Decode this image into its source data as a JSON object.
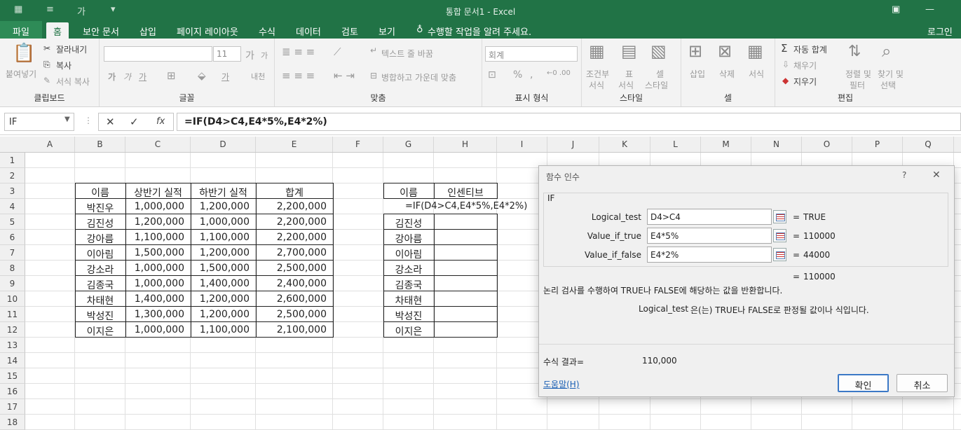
{
  "titlebar": {
    "title": "통합 문서1  -  Excel",
    "qa_undo": "↶",
    "qa_text": "가"
  },
  "tabs": {
    "file": "파일",
    "home": "홈",
    "insert_doc": "보안 문서",
    "insert": "삽입",
    "layout": "페이지 레이아웃",
    "formulas": "수식",
    "data": "데이터",
    "review": "검토",
    "view": "보기",
    "tell": "수행할 작업을 알려 주세요.",
    "login": "로그인"
  },
  "ribbon": {
    "clipboard": {
      "paste": "붙여넣기",
      "cut": "잘라내기",
      "copy": "복사",
      "format_painter": "서식 복사",
      "label": "클립보드"
    },
    "font": {
      "size": "11",
      "grow": "가",
      "shrink": "가",
      "bold": "가",
      "italic": "가",
      "underline": "가",
      "fontcolor": "가",
      "phonetic": "내천",
      "label": "글꼴"
    },
    "align": {
      "wrap": "텍스트 줄 바꿈",
      "merge": "병합하고 가운데 맞춤",
      "label": "맞춤"
    },
    "number": {
      "format": "회계",
      "percent": "%",
      "comma": ",",
      "label": "표시 형식"
    },
    "styles": {
      "cond": "조건부",
      "cond2": "서식",
      "table": "표",
      "table2": "서식",
      "cell": "셀",
      "cell2": "스타일",
      "label": "스타일"
    },
    "cells": {
      "insert": "삽입",
      "delete": "삭제",
      "format": "서식",
      "label": "셀"
    },
    "edit": {
      "autosum": "자동 합계",
      "fill": "채우기",
      "clear": "지우기",
      "sort": "정렬 및",
      "sort2": "필터",
      "find": "찾기 및",
      "find2": "선택",
      "label": "편집"
    }
  },
  "formula_bar": {
    "name_box": "IF",
    "formula": "=IF(D4>C4,E4*5%,E4*2%)",
    "fx": "fx"
  },
  "columns": [
    "A",
    "B",
    "C",
    "D",
    "E",
    "F",
    "G",
    "H",
    "I",
    "J",
    "K",
    "L",
    "M",
    "N",
    "O",
    "P",
    "Q"
  ],
  "rows": [
    "1",
    "2",
    "3",
    "4",
    "5",
    "6",
    "7",
    "8",
    "9",
    "10",
    "11",
    "12",
    "13",
    "14",
    "15",
    "16",
    "17",
    "18"
  ],
  "table1": {
    "headers": [
      "이름",
      "상반기 실적",
      "하반기 실적",
      "합계"
    ],
    "rows": [
      [
        "박진우",
        "1,000,000",
        "1,200,000",
        "2,200,000"
      ],
      [
        "김진성",
        "1,200,000",
        "1,000,000",
        "2,200,000"
      ],
      [
        "강아름",
        "1,100,000",
        "1,100,000",
        "2,200,000"
      ],
      [
        "이아림",
        "1,500,000",
        "1,200,000",
        "2,700,000"
      ],
      [
        "강소라",
        "1,000,000",
        "1,500,000",
        "2,500,000"
      ],
      [
        "김종국",
        "1,000,000",
        "1,400,000",
        "2,400,000"
      ],
      [
        "차태현",
        "1,400,000",
        "1,200,000",
        "2,600,000"
      ],
      [
        "박성진",
        "1,300,000",
        "1,200,000",
        "2,500,000"
      ],
      [
        "이지은",
        "1,000,000",
        "1,100,000",
        "2,100,000"
      ]
    ]
  },
  "table2": {
    "headers": [
      "이름",
      "인센티브"
    ],
    "editing_formula": "=IF(D4>C4,E4*5%,E4*2%)",
    "names": [
      "김진성",
      "강아름",
      "이아림",
      "강소라",
      "김종국",
      "차태현",
      "박성진",
      "이지은"
    ]
  },
  "dialog": {
    "title": "함수 인수",
    "help_q": "?",
    "close": "✕",
    "func": "IF",
    "args": [
      {
        "label": "Logical_test",
        "value": "D4>C4",
        "result": "TRUE"
      },
      {
        "label": "Value_if_true",
        "value": "E4*5%",
        "result": "110000"
      },
      {
        "label": "Value_if_false",
        "value": "E4*2%",
        "result": "44000"
      }
    ],
    "eq": "=",
    "overall_result": "110000",
    "description": "논리 검사를 수행하여 TRUE나 FALSE에 해당하는 값을 반환합니다.",
    "arg_help_name": "Logical_test",
    "arg_help_text": "은(는) TRUE나 FALSE로 판정될 값이나 식입니다.",
    "formula_result_label": "수식 결과=",
    "formula_result_value": "110,000",
    "help_link": "도움말(H)",
    "ok": "확인",
    "cancel": "취소"
  }
}
